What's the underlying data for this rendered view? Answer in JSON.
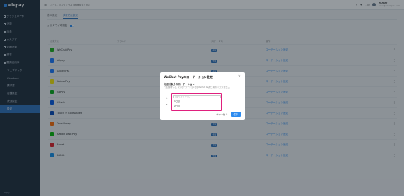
{
  "app": {
    "brand": "elepay",
    "account_name": "ELEPAY",
    "account_sub": "user@example.com"
  },
  "breadcrumb": [
    "ホーム",
    "カスタマイズ",
    "画面設定",
    "設定"
  ],
  "sidebar": {
    "items": [
      {
        "label": "ダッシュボード",
        "active": false,
        "sub": false
      },
      {
        "label": "決済",
        "active": false,
        "sub": false
      },
      {
        "label": "返金",
        "active": false,
        "sub": false
      },
      {
        "label": "カスタマー",
        "active": false,
        "sub": false
      },
      {
        "label": "定期決済",
        "active": false,
        "sub": false
      },
      {
        "label": "請求",
        "active": false,
        "sub": false
      },
      {
        "label": "開発者向け",
        "active": false,
        "sub": false
      },
      {
        "label": "ウェブフック",
        "active": false,
        "sub": true
      },
      {
        "label": "Checkout",
        "active": false,
        "sub": true
      },
      {
        "label": "請求書",
        "active": false,
        "sub": true
      },
      {
        "label": "店舗設定",
        "active": false,
        "sub": true
      },
      {
        "label": "決済設定",
        "active": false,
        "sub": true
      },
      {
        "label": "設定",
        "active": true,
        "sub": true
      }
    ],
    "footer": "elepay"
  },
  "tabs": [
    {
      "label": "基本設定",
      "active": false
    },
    {
      "label": "決済方法設定",
      "active": true
    }
  ],
  "customize": {
    "label": "カスタマイズ設定"
  },
  "table": {
    "headers": [
      "決済方法",
      "ブランド",
      "ステータス",
      "操作",
      ""
    ],
    "rows": [
      {
        "name": "WeChat Pay",
        "brand": "",
        "status": "有効",
        "action": "ローテーション設定",
        "color": "#1aad19"
      },
      {
        "name": "Alipay",
        "brand": "",
        "status": "有効",
        "action": "ローテーション設定",
        "color": "#1677ff"
      },
      {
        "name": "Alipay HK",
        "brand": "",
        "status": "有効",
        "action": "ローテーション設定",
        "color": "#1677ff"
      },
      {
        "name": "Kakao Pay",
        "brand": "",
        "status": "有効",
        "action": "ローテーション設定",
        "color": "#f7e600"
      },
      {
        "name": "GoPay",
        "brand": "",
        "status": "有効",
        "action": "ローテーション設定",
        "color": "#00aa13"
      },
      {
        "name": "GCash",
        "brand": "",
        "status": "有効",
        "action": "ローテーション設定",
        "color": "#0057e4"
      },
      {
        "name": "Touch 'n Go eWallet",
        "brand": "",
        "status": "有効",
        "action": "ローテーション設定",
        "color": "#0046b8"
      },
      {
        "name": "TrueMoney",
        "brand": "",
        "status": "有効",
        "action": "ローテーション設定",
        "color": "#ff6b00"
      },
      {
        "name": "Rabbit LINE Pay",
        "brand": "",
        "status": "有効",
        "action": "ローテーション設定",
        "color": "#00b900"
      },
      {
        "name": "Boost",
        "brand": "",
        "status": "有効",
        "action": "ローテーション設定",
        "color": "#e21c24"
      },
      {
        "name": "DANA",
        "brand": "",
        "status": "有効",
        "action": "ローテーション設定",
        "color": "#118ee9"
      }
    ]
  },
  "modal": {
    "title": "WeChat Payのローテーション設定",
    "subtitle": "利用対象外のローテーション",
    "description": "一度選択すると、そのローテーションではWeChat Payをご利用いただけません。",
    "select_placeholder": "選択してください",
    "options": [
      "1日目",
      "2日目"
    ],
    "cancel": "キャンセル",
    "save": "保存"
  }
}
